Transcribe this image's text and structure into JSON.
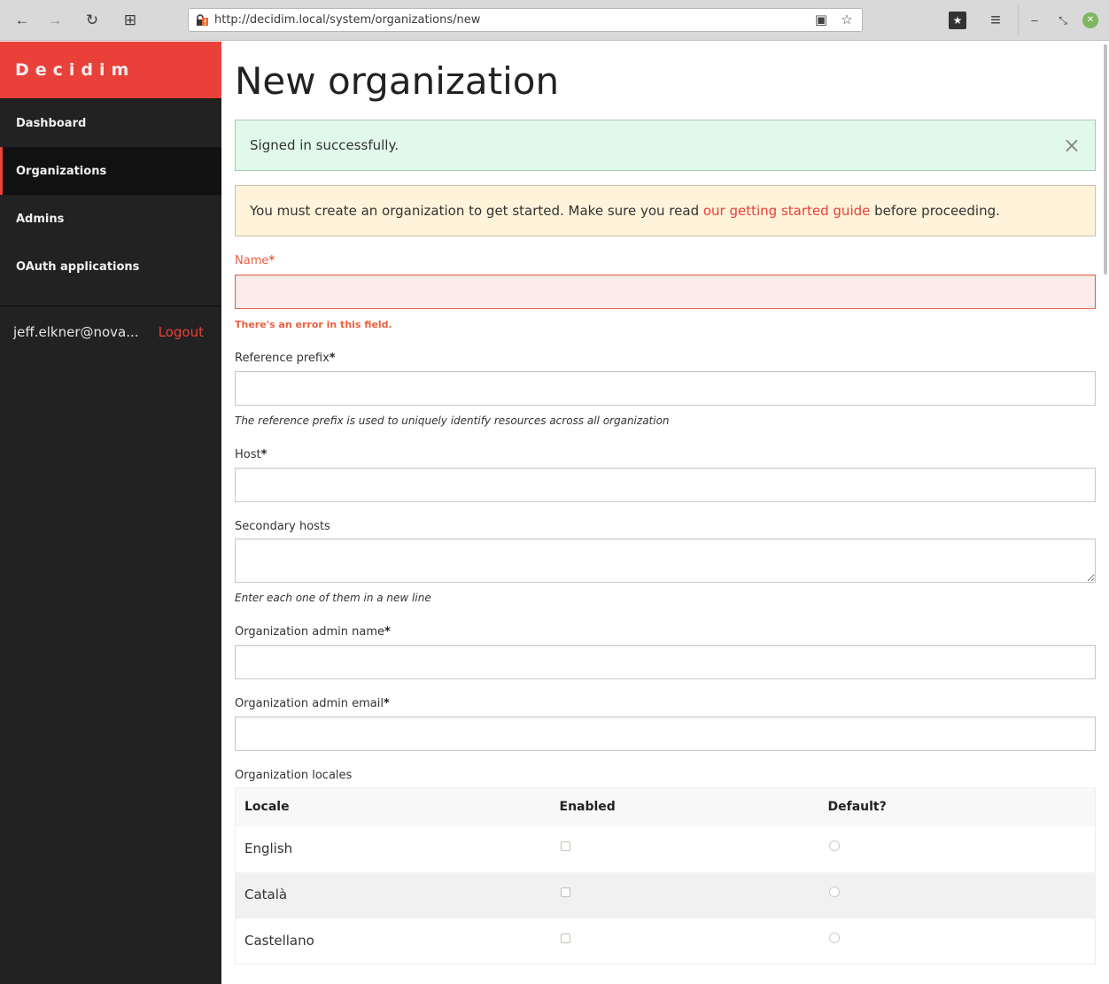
{
  "browser": {
    "url": "http://decidim.local/system/organizations/new",
    "nav": {
      "back_icon": "←",
      "forward_icon": "→",
      "reload_icon": "↻",
      "new_tab_icon": "⊞"
    },
    "reader_icon": "▣",
    "bookmark_icon": "☆",
    "bookmarks_icon": "★",
    "menu_icon": "≡",
    "minimize_icon": "–",
    "restore_icon": "⤡",
    "close_icon": "✕"
  },
  "sidebar": {
    "brand": "Decidim",
    "items": [
      {
        "label": "Dashboard",
        "active": false
      },
      {
        "label": "Organizations",
        "active": true
      },
      {
        "label": "Admins",
        "active": false
      },
      {
        "label": "OAuth applications",
        "active": false
      }
    ],
    "user": "jeff.elkner@nova...",
    "logout": "Logout"
  },
  "main": {
    "title": "New organization",
    "flash_success": "Signed in successfully.",
    "flash_close": "×",
    "warning": {
      "before": "You must create an organization to get started. Make sure you read ",
      "link": "our getting started guide",
      "after": " before proceeding."
    },
    "form": {
      "name": {
        "label": "Name",
        "required": "*",
        "value": "",
        "error": "There's an error in this field."
      },
      "reference_prefix": {
        "label": "Reference prefix",
        "required": "*",
        "value": "",
        "help": "The reference prefix is used to uniquely identify resources across all organization"
      },
      "host": {
        "label": "Host",
        "required": "*",
        "value": ""
      },
      "secondary_hosts": {
        "label": "Secondary hosts",
        "value": "",
        "help": "Enter each one of them in a new line"
      },
      "admin_name": {
        "label": "Organization admin name",
        "required": "*",
        "value": ""
      },
      "admin_email": {
        "label": "Organization admin email",
        "required": "*",
        "value": ""
      },
      "locales": {
        "label": "Organization locales",
        "headers": [
          "Locale",
          "Enabled",
          "Default?"
        ],
        "rows": [
          {
            "locale": "English",
            "enabled": false,
            "default": false
          },
          {
            "locale": "Català",
            "enabled": false,
            "default": false
          },
          {
            "locale": "Castellano",
            "enabled": false,
            "default": false
          }
        ]
      }
    }
  },
  "colors": {
    "brand": "#e9403a",
    "sidebar_bg": "#222222",
    "success_bg": "#e1f9ea",
    "warning_bg": "#fff3d9",
    "error": "#e9603e"
  }
}
